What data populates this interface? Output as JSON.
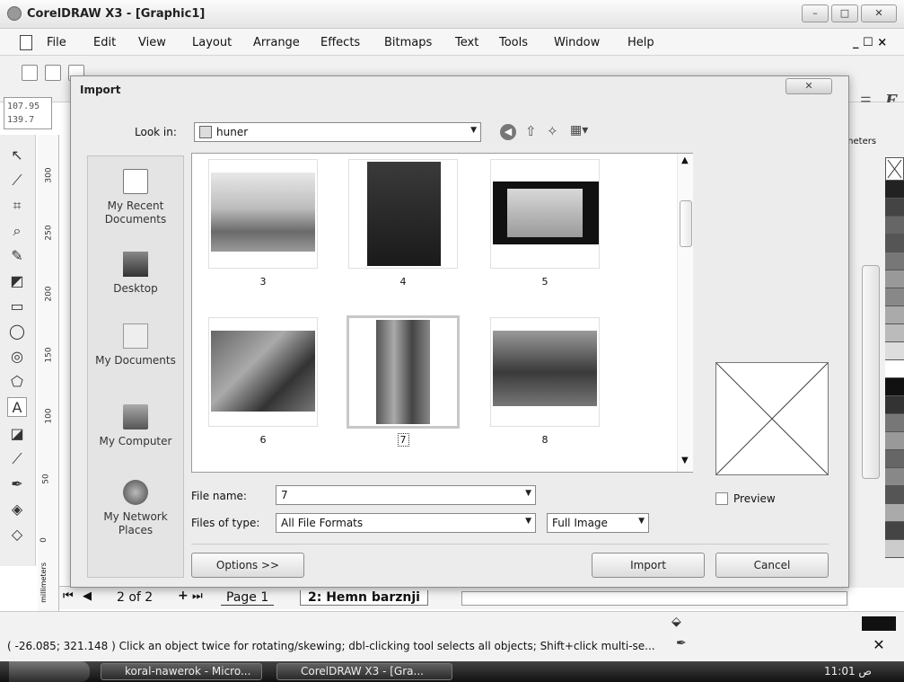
{
  "app": {
    "title": "CorelDRAW X3 - [Graphic1]",
    "window_controls": [
      "–",
      "□",
      "✕"
    ]
  },
  "menu": {
    "items": [
      "File",
      "Edit",
      "View",
      "Layout",
      "Arrange",
      "Effects",
      "Bitmaps",
      "Text",
      "Tools",
      "Window",
      "Help"
    ],
    "doc_controls": "_ ☐ ×"
  },
  "coords": {
    "x": "107.95",
    "y": "139.7"
  },
  "ruler": {
    "unit": "millimeters",
    "ticks": [
      "300",
      "250",
      "200",
      "150",
      "100",
      "50",
      "0"
    ]
  },
  "right_unit": "imeters",
  "dialog": {
    "title": "Import",
    "close": "✕",
    "look_in_label": "Look in:",
    "look_in_value": "huner",
    "places": [
      {
        "label": "My Recent Documents",
        "icon": "recent-documents-icon"
      },
      {
        "label": "Desktop",
        "icon": "desktop-icon"
      },
      {
        "label": "My Documents",
        "icon": "my-documents-icon"
      },
      {
        "label": "My Computer",
        "icon": "my-computer-icon"
      },
      {
        "label": "My Network Places",
        "icon": "network-places-icon"
      }
    ],
    "files": [
      {
        "name": "3"
      },
      {
        "name": "4"
      },
      {
        "name": "5"
      },
      {
        "name": "6"
      },
      {
        "name": "7"
      },
      {
        "name": "8"
      }
    ],
    "selected_file": "7",
    "file_name_label": "File name:",
    "file_name_value": "7",
    "file_type_label": "Files of type:",
    "file_type_value": "All File Formats",
    "image_mode": "Full Image",
    "preview_label": "Preview",
    "options_button": "Options >>",
    "import_button": "Import",
    "cancel_button": "Cancel"
  },
  "pages": {
    "counter": "2 of 2",
    "tab1": "Page 1",
    "tab2": "2: Hemn barznji"
  },
  "status": {
    "text": "( -26.085; 321.148 )   Click an object twice for rotating/skewing; dbl-clicking tool selects all objects; Shift+click multi-se..."
  },
  "taskbar": {
    "tasks": [
      "koral-nawerok - Micro...",
      "CorelDRAW X3 - [Gra..."
    ],
    "clock": "11:01 ص"
  }
}
